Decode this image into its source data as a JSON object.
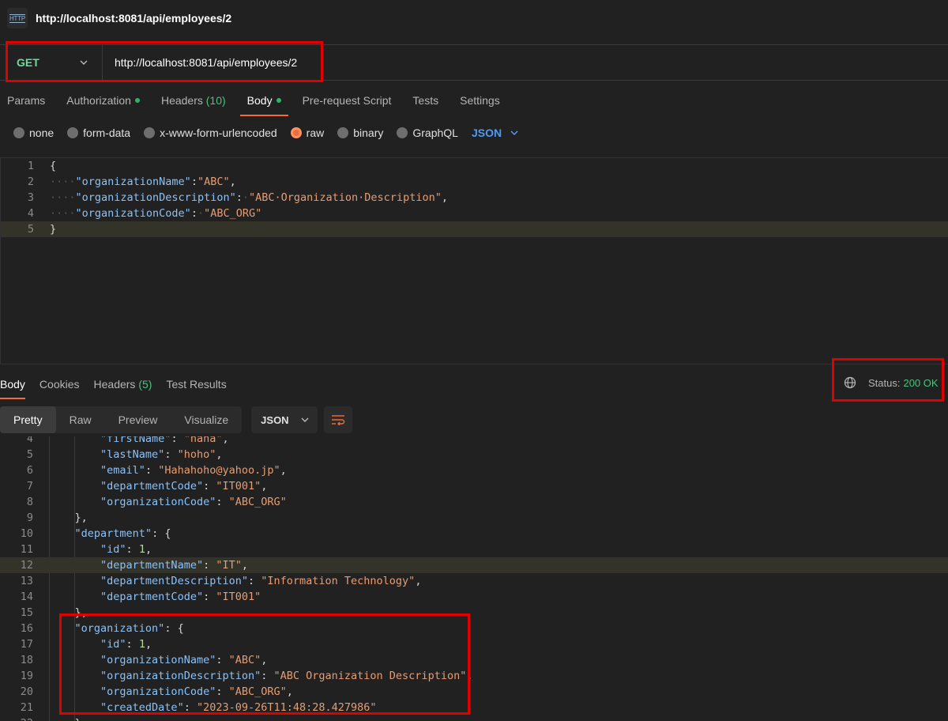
{
  "window": {
    "title": "http://localhost:8081/api/employees/2",
    "icon": "http-file-icon",
    "icon_text": "HTTP"
  },
  "request": {
    "method": "GET",
    "url": "http://localhost:8081/api/employees/2"
  },
  "request_tabs": [
    {
      "label": "Params"
    },
    {
      "label": "Authorization",
      "dot": true
    },
    {
      "label": "Headers",
      "count": "(10)"
    },
    {
      "label": "Body",
      "dot": true,
      "active": true
    },
    {
      "label": "Pre-request Script"
    },
    {
      "label": "Tests"
    },
    {
      "label": "Settings"
    }
  ],
  "body_types": [
    {
      "label": "none"
    },
    {
      "label": "form-data"
    },
    {
      "label": "x-www-form-urlencoded"
    },
    {
      "label": "raw",
      "selected": true
    },
    {
      "label": "binary"
    },
    {
      "label": "GraphQL"
    }
  ],
  "body_format": "JSON",
  "request_body": [
    {
      "n": "1",
      "t": [
        [
          "pun",
          "{"
        ]
      ]
    },
    {
      "n": "2",
      "t": [
        [
          "ws",
          "····"
        ],
        [
          "key",
          "\"organizationName\""
        ],
        [
          "pun",
          ":"
        ],
        [
          "str",
          "\"ABC\""
        ],
        [
          "pun",
          ","
        ]
      ]
    },
    {
      "n": "3",
      "t": [
        [
          "ws",
          "····"
        ],
        [
          "key",
          "\"organizationDescription\""
        ],
        [
          "pun",
          ":"
        ],
        [
          "ws",
          "·"
        ],
        [
          "str",
          "\"ABC·Organization·Description\""
        ],
        [
          "pun",
          ","
        ]
      ]
    },
    {
      "n": "4",
      "t": [
        [
          "ws",
          "····"
        ],
        [
          "key",
          "\"organizationCode\""
        ],
        [
          "pun",
          ":"
        ],
        [
          "ws",
          "·"
        ],
        [
          "str",
          "\"ABC_ORG\""
        ]
      ]
    },
    {
      "n": "5",
      "t": [
        [
          "pun",
          "}"
        ]
      ],
      "hl": true
    }
  ],
  "response_tabs": [
    {
      "label": "Body",
      "active": true
    },
    {
      "label": "Cookies"
    },
    {
      "label": "Headers",
      "count": "(5)"
    },
    {
      "label": "Test Results"
    }
  ],
  "status": {
    "label": "Status:",
    "value": "200 OK"
  },
  "response_views": [
    {
      "label": "Pretty",
      "active": true
    },
    {
      "label": "Raw"
    },
    {
      "label": "Preview"
    },
    {
      "label": "Visualize"
    }
  ],
  "response_format": "JSON",
  "response_body": [
    {
      "n": "4",
      "t": [
        [
          "sp",
          "        "
        ],
        [
          "key",
          "\"firstName\""
        ],
        [
          "pun",
          ": "
        ],
        [
          "str",
          "\"haha\""
        ],
        [
          "pun",
          ","
        ]
      ]
    },
    {
      "n": "5",
      "t": [
        [
          "sp",
          "        "
        ],
        [
          "key",
          "\"lastName\""
        ],
        [
          "pun",
          ": "
        ],
        [
          "str",
          "\"hoho\""
        ],
        [
          "pun",
          ","
        ]
      ]
    },
    {
      "n": "6",
      "t": [
        [
          "sp",
          "        "
        ],
        [
          "key",
          "\"email\""
        ],
        [
          "pun",
          ": "
        ],
        [
          "str",
          "\"Hahahoho@yahoo.jp\""
        ],
        [
          "pun",
          ","
        ]
      ]
    },
    {
      "n": "7",
      "t": [
        [
          "sp",
          "        "
        ],
        [
          "key",
          "\"departmentCode\""
        ],
        [
          "pun",
          ": "
        ],
        [
          "str",
          "\"IT001\""
        ],
        [
          "pun",
          ","
        ]
      ]
    },
    {
      "n": "8",
      "t": [
        [
          "sp",
          "        "
        ],
        [
          "key",
          "\"organizationCode\""
        ],
        [
          "pun",
          ": "
        ],
        [
          "str",
          "\"ABC_ORG\""
        ]
      ]
    },
    {
      "n": "9",
      "t": [
        [
          "sp",
          "    "
        ],
        [
          "pun",
          "},"
        ]
      ]
    },
    {
      "n": "10",
      "t": [
        [
          "sp",
          "    "
        ],
        [
          "key",
          "\"department\""
        ],
        [
          "pun",
          ": {"
        ]
      ]
    },
    {
      "n": "11",
      "t": [
        [
          "sp",
          "        "
        ],
        [
          "key",
          "\"id\""
        ],
        [
          "pun",
          ": "
        ],
        [
          "num",
          "1"
        ],
        [
          "pun",
          ","
        ]
      ]
    },
    {
      "n": "12",
      "t": [
        [
          "sp",
          "        "
        ],
        [
          "key",
          "\"departmentName\""
        ],
        [
          "pun",
          ": "
        ],
        [
          "str",
          "\"IT\""
        ],
        [
          "pun",
          ","
        ]
      ],
      "hl": true
    },
    {
      "n": "13",
      "t": [
        [
          "sp",
          "        "
        ],
        [
          "key",
          "\"departmentDescription\""
        ],
        [
          "pun",
          ": "
        ],
        [
          "str",
          "\"Information Technology\""
        ],
        [
          "pun",
          ","
        ]
      ]
    },
    {
      "n": "14",
      "t": [
        [
          "sp",
          "        "
        ],
        [
          "key",
          "\"departmentCode\""
        ],
        [
          "pun",
          ": "
        ],
        [
          "str",
          "\"IT001\""
        ]
      ]
    },
    {
      "n": "15",
      "t": [
        [
          "sp",
          "    "
        ],
        [
          "pun",
          "},"
        ]
      ]
    },
    {
      "n": "16",
      "t": [
        [
          "sp",
          "    "
        ],
        [
          "key",
          "\"organization\""
        ],
        [
          "pun",
          ": {"
        ]
      ]
    },
    {
      "n": "17",
      "t": [
        [
          "sp",
          "        "
        ],
        [
          "key",
          "\"id\""
        ],
        [
          "pun",
          ": "
        ],
        [
          "num",
          "1"
        ],
        [
          "pun",
          ","
        ]
      ]
    },
    {
      "n": "18",
      "t": [
        [
          "sp",
          "        "
        ],
        [
          "key",
          "\"organizationName\""
        ],
        [
          "pun",
          ": "
        ],
        [
          "str",
          "\"ABC\""
        ],
        [
          "pun",
          ","
        ]
      ]
    },
    {
      "n": "19",
      "t": [
        [
          "sp",
          "        "
        ],
        [
          "key",
          "\"organizationDescription\""
        ],
        [
          "pun",
          ": "
        ],
        [
          "str",
          "\"ABC Organization Description\""
        ],
        [
          "pun",
          ","
        ]
      ]
    },
    {
      "n": "20",
      "t": [
        [
          "sp",
          "        "
        ],
        [
          "key",
          "\"organizationCode\""
        ],
        [
          "pun",
          ": "
        ],
        [
          "str",
          "\"ABC_ORG\""
        ],
        [
          "pun",
          ","
        ]
      ]
    },
    {
      "n": "21",
      "t": [
        [
          "sp",
          "        "
        ],
        [
          "key",
          "\"createdDate\""
        ],
        [
          "pun",
          ": "
        ],
        [
          "str",
          "\"2023-09-26T11:48:28.427986\""
        ]
      ]
    },
    {
      "n": "22",
      "t": [
        [
          "sp",
          "    "
        ],
        [
          "pun",
          "}"
        ]
      ]
    }
  ],
  "colors": {
    "accent": "#f26b3a",
    "success": "#4bc37d",
    "method_get": "#6bdd9a",
    "highlight_box": "#e00000",
    "json_type": "#4f9cf2"
  }
}
